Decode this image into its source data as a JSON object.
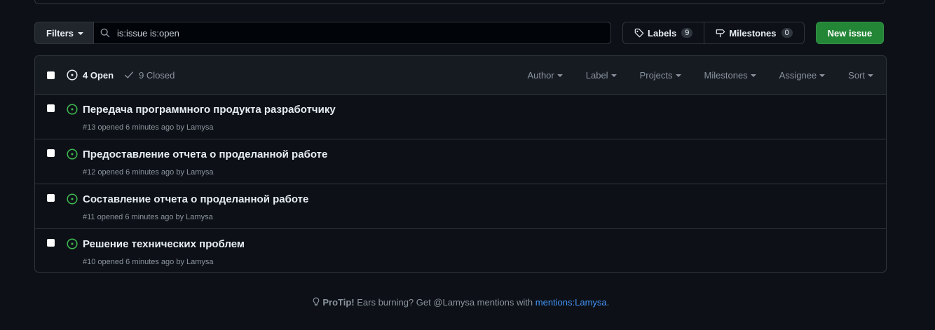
{
  "toolbar": {
    "filters_label": "Filters",
    "search_value": "is:issue is:open",
    "labels_label": "Labels",
    "labels_count": "9",
    "milestones_label": "Milestones",
    "milestones_count": "0",
    "new_issue_label": "New issue"
  },
  "list_header": {
    "open_label": "4 Open",
    "closed_label": "9 Closed",
    "filters": [
      "Author",
      "Label",
      "Projects",
      "Milestones",
      "Assignee",
      "Sort"
    ]
  },
  "issues": [
    {
      "title": "Передача программного продукта разработчику",
      "meta": "#13 opened 6 minutes ago by Lamysa"
    },
    {
      "title": "Предоставление отчета о проделанной работе",
      "meta": "#12 opened 6 minutes ago by Lamysa"
    },
    {
      "title": "Составление отчета о проделанной работе",
      "meta": "#11 opened 6 minutes ago by Lamysa"
    },
    {
      "title": "Решение технических проблем",
      "meta": "#10 opened 6 minutes ago by Lamysa"
    }
  ],
  "protip": {
    "label": "ProTip!",
    "text": " Ears burning? Get @Lamysa mentions with ",
    "link": "mentions:Lamysa",
    "end": "."
  },
  "colors": {
    "background": "#0d1117",
    "open_icon": "#3fb950",
    "new_issue_button": "#238636",
    "link": "#4493f8"
  },
  "icons": [
    "search-icon",
    "tag-icon",
    "milestone-icon",
    "issue-opened-icon",
    "check-icon",
    "lightbulb-icon"
  ]
}
